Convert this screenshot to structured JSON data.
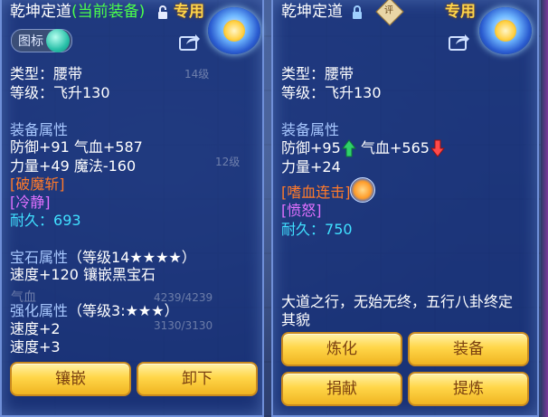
{
  "left": {
    "title_name": "乾坤定道",
    "title_status": "(当前装备)",
    "special_label": "专用",
    "toggle_label": "图标",
    "type_line": "类型：腰带",
    "level_line": "等级：飞升130",
    "attr_header": "装备属性",
    "attr_line1": "防御+91 气血+587",
    "attr_line2": "力量+49 魔法-160",
    "skill1": "[破魔斩]",
    "skill2": "[冷静]",
    "durability_label": "耐久：",
    "durability_value": "693",
    "gem_header": "宝石属性",
    "gem_level": "（等级14★★★★）",
    "gem_line": "速度+120 镶嵌黑宝石",
    "enhance_header": "强化属性",
    "enhance_level": "（等级3:★★★）",
    "enhance_line1": "速度+2",
    "enhance_line2": "速度+3",
    "bg_text1": "4239/4239",
    "bg_text2": "3130/3130",
    "bg_text3": "气血",
    "bg_text4": "14级",
    "bg_text5": "12级",
    "btn_inlay": "镶嵌",
    "btn_unequip": "卸下"
  },
  "right": {
    "title_name": "乾坤定道",
    "special_label": "专用",
    "diamond_text": "评",
    "type_line": "类型：腰带",
    "level_line": "等级：飞升130",
    "attr_header": "装备属性",
    "attr_line1a": "防御+95",
    "attr_line1b": "气血+565",
    "attr_line2": "力量+24",
    "skill1": "[嗜血连击]",
    "skill2": "[愤怒]",
    "durability_label": "耐久：",
    "durability_value": "750",
    "desc_line1": "大道之行，无始无终，五行八卦终定",
    "desc_line2": "其貌",
    "btn_refine": "炼化",
    "btn_equip": "装备",
    "btn_donate": "捐献",
    "btn_extract": "提炼"
  },
  "colors": {
    "green": "#4bff4b",
    "label_blue": "#a8c8ff",
    "skill_orange": "#ff7a2a",
    "skill_purple": "#e070ff",
    "durability_cyan": "#40e0ff",
    "button_gold": "#ffd648",
    "special_gold": "#ffd54a"
  },
  "icons": {
    "lock": "lock-icon",
    "share": "share-icon",
    "up": "arrow-up-icon",
    "down": "arrow-down-icon"
  }
}
